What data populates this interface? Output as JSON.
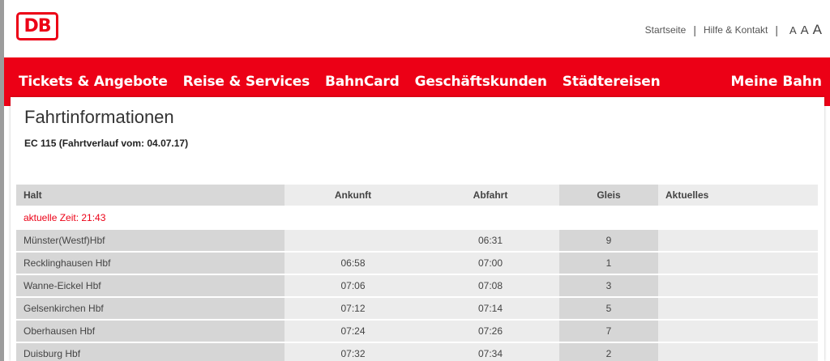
{
  "header": {
    "logo_text": "DB",
    "links": {
      "startseite": "Startseite",
      "hilfe": "Hilfe & Kontakt"
    },
    "font_sizes": [
      "A",
      "A",
      "A"
    ]
  },
  "nav": {
    "items": [
      "Tickets & Angebote",
      "Reise & Services",
      "BahnCard",
      "Geschäftskunden",
      "Städtereisen"
    ],
    "right": "Meine Bahn",
    "color": "#ec0016"
  },
  "main": {
    "title": "Fahrtinformationen",
    "train_info": "EC 115 (Fahrtverlauf vom: 04.07.17)",
    "current_time": "aktuelle Zeit: 21:43",
    "columns": [
      "Halt",
      "Ankunft",
      "Abfahrt",
      "Gleis",
      "Aktuelles"
    ],
    "rows": [
      {
        "halt": "Münster(Westf)Hbf",
        "ankunft": "",
        "abfahrt": "06:31",
        "gleis": "9",
        "aktuelles": ""
      },
      {
        "halt": "Recklinghausen Hbf",
        "ankunft": "06:58",
        "abfahrt": "07:00",
        "gleis": "1",
        "aktuelles": ""
      },
      {
        "halt": "Wanne-Eickel Hbf",
        "ankunft": "07:06",
        "abfahrt": "07:08",
        "gleis": "3",
        "aktuelles": ""
      },
      {
        "halt": "Gelsenkirchen Hbf",
        "ankunft": "07:12",
        "abfahrt": "07:14",
        "gleis": "5",
        "aktuelles": ""
      },
      {
        "halt": "Oberhausen Hbf",
        "ankunft": "07:24",
        "abfahrt": "07:26",
        "gleis": "7",
        "aktuelles": ""
      },
      {
        "halt": "Duisburg Hbf",
        "ankunft": "07:32",
        "abfahrt": "07:34",
        "gleis": "2",
        "aktuelles": ""
      }
    ]
  }
}
